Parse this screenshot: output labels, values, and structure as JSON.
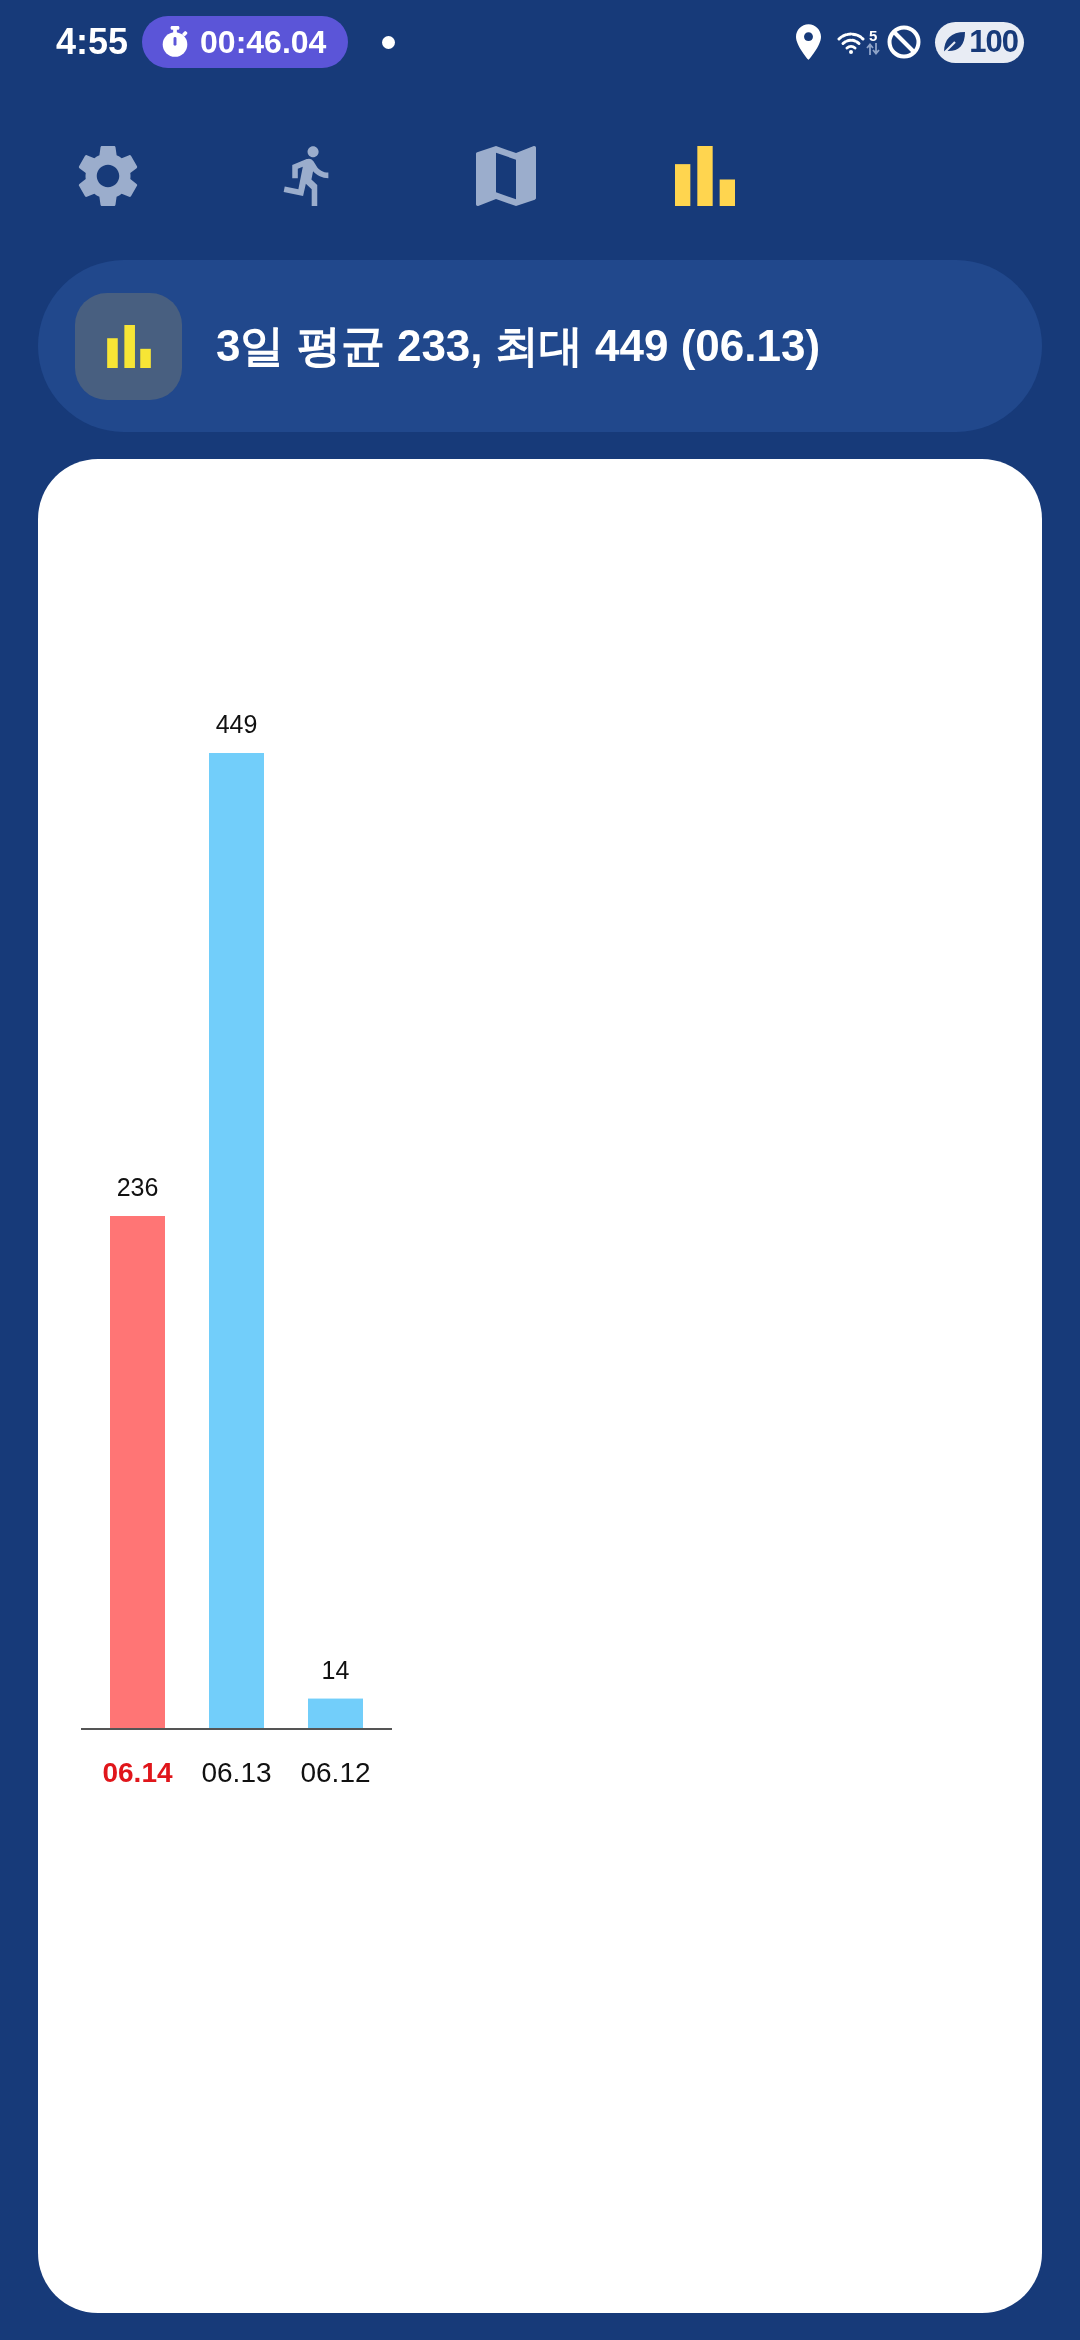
{
  "status_bar": {
    "time": "4:55",
    "timer": "00:46.04",
    "wifi_standard": "5",
    "battery": "100"
  },
  "tabs": [
    {
      "kind": "settings",
      "selected": false
    },
    {
      "kind": "running",
      "selected": false
    },
    {
      "kind": "map",
      "selected": false
    },
    {
      "kind": "chart",
      "selected": true
    }
  ],
  "summary": {
    "text": "3일 평균 233, 최대 449 (06.13)"
  },
  "chart_panel": {
    "chart_data": {
      "type": "bar",
      "categories": [
        "06.14",
        "06.13",
        "06.12"
      ],
      "series": [
        {
          "color": "#ff7575",
          "values": [
            236,
            null,
            null
          ]
        },
        {
          "color": "#72cefa",
          "values": [
            null,
            449,
            14
          ]
        }
      ],
      "stacked": true,
      "data_labels": true
    }
  }
}
